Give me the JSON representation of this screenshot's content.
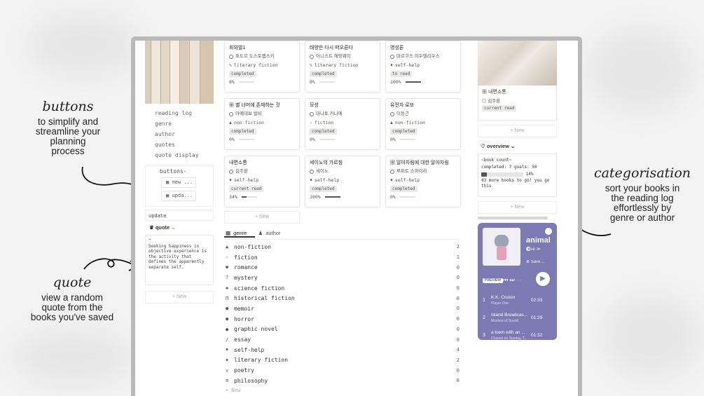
{
  "annotations": {
    "buttons": {
      "title": "buttons",
      "desc": [
        "to simplify and",
        "streamline your",
        "planning",
        "process"
      ]
    },
    "quote": {
      "title": "quote",
      "desc": [
        "view a random",
        "quote from the",
        "books you've saved"
      ]
    },
    "categorisation": {
      "title": "categorisation",
      "desc": [
        "sort your books in",
        "the reading log",
        "effortlessly by",
        "genre or author"
      ]
    }
  },
  "left": {
    "nav": [
      "reading log",
      "genre",
      "author",
      "quotes",
      "quote display"
    ],
    "buttons_heading": "buttons-",
    "buttons": [
      "new ...",
      "upda..."
    ],
    "update": "update",
    "quote_heading": "quote",
    "quote_text": "Seeking happiness in objective experience is the activity that defines the apparently separate self.",
    "new": "+ New"
  },
  "gallery": {
    "cards": [
      {
        "title": "죄와벌1",
        "author": "표도르 도스토옙스키",
        "genre": "literary fiction",
        "status": "completed",
        "progress": "0%",
        "pct": 0
      },
      {
        "title": "태양은 다시 떠오른다",
        "author": "어니스트 헤밍웨이",
        "genre": "literary fiction",
        "status": "completed",
        "progress": "0%",
        "pct": 0
      },
      {
        "title": "영성론",
        "author": "마르쿠스 아우렐리우스",
        "genre": "self-help",
        "status": "to read",
        "progress": "100%",
        "pct": 100
      },
      {
        "title": "별 너머에 존재하는 것",
        "author": "아예데보 발비",
        "genre": "non-fiction",
        "status": "completed",
        "progress": "0%",
        "pct": 0
      },
      {
        "title": "모성",
        "author": "마나토 카나에",
        "genre": "fiction",
        "status": "completed",
        "progress": "0%",
        "pct": 0
      },
      {
        "title": "유전자 로또",
        "author": "이동근",
        "genre": "non-fiction",
        "status": "completed",
        "progress": "0%",
        "pct": 0
      },
      {
        "title": "내면소통",
        "author": "김주환",
        "genre": "self-help",
        "status": "current read",
        "progress": "34%",
        "pct": 34
      },
      {
        "title": "세이노의 가르침",
        "author": "세이노",
        "genre": "self-help",
        "status": "completed",
        "progress": "100%",
        "pct": 100
      },
      {
        "title": "알아차림에 대한 알아차림",
        "author": "루퍼트 스파이라",
        "genre": "self-help",
        "status": "completed",
        "progress": "0%",
        "pct": 0
      }
    ],
    "new": "+ New",
    "tabs": [
      "genre",
      "author"
    ]
  },
  "genres": [
    {
      "name": "non-fiction",
      "icon": "▲",
      "count": "2"
    },
    {
      "name": "fiction",
      "icon": "✧",
      "count": "1"
    },
    {
      "name": "romance",
      "icon": "♥",
      "count": "0"
    },
    {
      "name": "mystery",
      "icon": "?",
      "count": "0"
    },
    {
      "name": "science fiction",
      "icon": "✺",
      "count": "0"
    },
    {
      "name": "historical fiction",
      "icon": "Π",
      "count": "0"
    },
    {
      "name": "memoir",
      "icon": "●",
      "count": "0"
    },
    {
      "name": "horror",
      "icon": "●",
      "count": "0"
    },
    {
      "name": "graphic novel",
      "icon": "●",
      "count": "0"
    },
    {
      "name": "essay",
      "icon": "/",
      "count": "0"
    },
    {
      "name": "self-help",
      "icon": "♦",
      "count": "4"
    },
    {
      "name": "literary fiction",
      "icon": "♦",
      "count": "2"
    },
    {
      "name": "poetry",
      "icon": "✕",
      "count": "0"
    },
    {
      "name": "philosophy",
      "icon": "≡",
      "count": "0"
    }
  ],
  "genre_new": "+ New",
  "right": {
    "card_title": "내면소통",
    "card_author": "김주환",
    "card_status": "current read",
    "new": "+ New",
    "overview": "overview",
    "count_title": "~book count~",
    "count_line": "completed: 7 goals: 50",
    "count_pct": "14%",
    "count_fill": 0.14,
    "count_more": "43 more books to go!  you go this",
    "player": {
      "title": "animal c",
      "artist": "rosie ≫",
      "save": "Save ...",
      "preview": "PREVIEW",
      "tracks": [
        {
          "n": "1",
          "name": "K.K. Cruisin",
          "artist": "Player One",
          "dur": "02:33"
        },
        {
          "n": "2",
          "name": "Island Broadcas...",
          "artist": "Masters of Sound",
          "dur": "01:29"
        },
        {
          "n": "3",
          "name": "a town with an ...",
          "artist": "Chased on Sunday, T...",
          "dur": "01:32"
        }
      ]
    }
  }
}
